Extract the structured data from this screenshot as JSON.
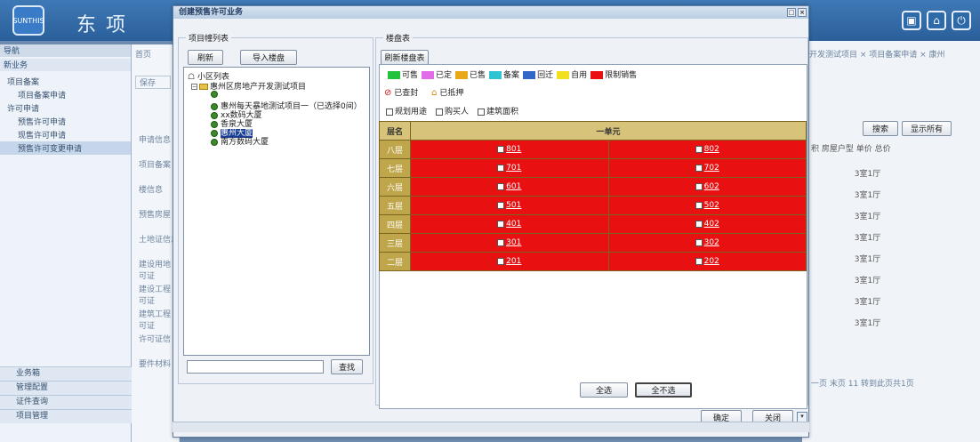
{
  "app": {
    "title": "东 项",
    "logo_text": "SUNTHIS"
  },
  "sidebar": {
    "header": "导航",
    "sub_header": "新业务",
    "items": [
      {
        "label": "项目备案",
        "indent": 0
      },
      {
        "label": "项目备案申请",
        "indent": 1
      },
      {
        "label": "许可申请",
        "indent": 0
      },
      {
        "label": "预售许可申请",
        "indent": 1
      },
      {
        "label": "现售许可申请",
        "indent": 1
      },
      {
        "label": "预售许可变更申请",
        "indent": 1
      }
    ],
    "footer": [
      "业务箱",
      "管理配置",
      "证件查询",
      "项目管理"
    ]
  },
  "background": {
    "tab_first": "首页",
    "save_btn": "保存",
    "col_labels": [
      "申请信息",
      "项目备案",
      "楼信息",
      "预售房屋",
      "土地证信息",
      "建设用地\n可证",
      "建设工程\n可证",
      "建筑工程\n可证",
      "许可证信",
      "要件材料"
    ],
    "tabs_right": "开发测试项目 × 项目备案申请 × 康州",
    "search_btn": "搜索",
    "show_all_btn": "显示所有",
    "col_headers": "积  房屋户型  单价  总价",
    "house_type": "3室1厅",
    "pager": "一页 末页 11  转到此页共1页"
  },
  "dialog": {
    "title": "创建预售许可业务",
    "left_legend": "项目幢列表",
    "refresh_btn": "刷新",
    "import_btn": "导入楼盘",
    "tree": {
      "root": "小区列表",
      "company": "惠州区房地产开发测试项目",
      "items": [
        "惠州每天暴地测试项目一（已选择0间）",
        "xx数码大厦",
        "香泉大厦",
        "惠州大厦",
        "南方数码大厦"
      ],
      "selected_index": 3
    },
    "search_btn": "查找",
    "right_legend": "楼盘表",
    "refresh_table_btn": "刷新楼盘表",
    "legend": [
      {
        "label": "可售",
        "color": "#22c33a"
      },
      {
        "label": "已定",
        "color": "#e26ce8"
      },
      {
        "label": "已售",
        "color": "#e8a81a"
      },
      {
        "label": "备案",
        "color": "#2fc3d3"
      },
      {
        "label": "回迁",
        "color": "#3168c8"
      },
      {
        "label": "自用",
        "color": "#f2e01e"
      },
      {
        "label": "限制销售",
        "color": "#e81010"
      }
    ],
    "sealed_label": "已查封",
    "mortgaged_label": "已抵押",
    "options": [
      "规划用途",
      "购买人",
      "建筑面积"
    ],
    "table": {
      "floor_header": "层名",
      "unit_header": "一单元",
      "rows": [
        {
          "floor": "八层",
          "left": "801",
          "right": "802"
        },
        {
          "floor": "七层",
          "left": "701",
          "right": "702"
        },
        {
          "floor": "六层",
          "left": "601",
          "right": "602"
        },
        {
          "floor": "五层",
          "left": "501",
          "right": "502"
        },
        {
          "floor": "四层",
          "left": "401",
          "right": "402"
        },
        {
          "floor": "三层",
          "left": "301",
          "right": "302"
        },
        {
          "floor": "二层",
          "left": "201",
          "right": "202"
        }
      ]
    },
    "select_all_btn": "全选",
    "deselect_all_btn": "全不选",
    "ok_btn": "确定",
    "close_btn": "关闭"
  }
}
